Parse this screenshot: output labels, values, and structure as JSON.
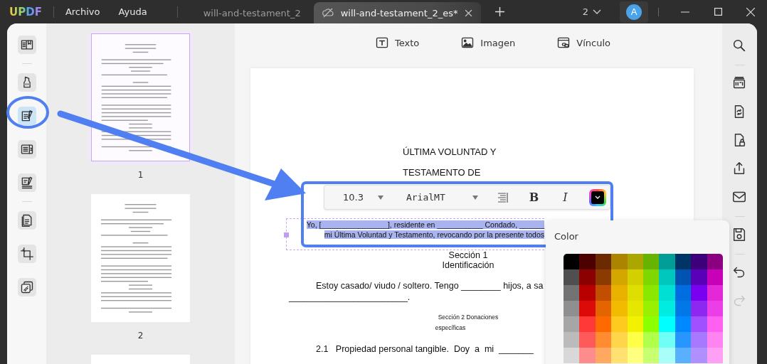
{
  "app": {
    "logo": "UPDF",
    "menu": [
      {
        "label": "Archivo"
      },
      {
        "label": "Ayuda"
      }
    ]
  },
  "tabs": [
    {
      "label": "will-and-testament_2",
      "selected": false
    },
    {
      "label": "will-and-testament_2_es*",
      "selected": true
    }
  ],
  "page_switcher": {
    "label": "2"
  },
  "user": {
    "initial": "A"
  },
  "left_toolbar": {
    "groups": [
      [
        {
          "selected": false
        }
      ],
      [
        {
          "selected": false
        },
        {
          "selected": true
        },
        {
          "selected": false
        },
        {
          "selected": false
        }
      ],
      [
        {
          "selected": false
        },
        {
          "selected": false
        },
        {
          "selected": false
        }
      ]
    ]
  },
  "thumbnails": [
    {
      "label": "1",
      "selected": true
    },
    {
      "label": "2",
      "selected": false
    },
    {
      "selected": false
    }
  ],
  "edit_toolbar": [
    {
      "label": "Texto"
    },
    {
      "label": "Imagen"
    },
    {
      "label": "Vínculo"
    }
  ],
  "document": {
    "blocks": [
      {
        "kind": "title",
        "selected": false,
        "lines": [
          "ÚLTIMA VOLUNTAD Y",
          "TESTAMENTO DE"
        ]
      },
      {
        "kind": "paragraph-right",
        "selected": true,
        "lines": [
          "Yo, [________________], residente en ___________ Condado, ______",
          "mi Última Voluntad y Testamento, revocando por la presente todos"
        ]
      },
      {
        "kind": "heading",
        "selected": false,
        "lines": [
          "Sección 1",
          "Identificación"
        ]
      },
      {
        "kind": "paragraph",
        "selected": false,
        "lines": [
          "Estoy casado/ viudo / soltero. Tengo ________ hijos, a sa",
          "________________________."
        ]
      },
      {
        "kind": "small-heading",
        "selected": false,
        "lines": [
          "Sección 2 Donaciones",
          "específicas"
        ]
      },
      {
        "kind": "paragraph",
        "selected": false,
        "lines": [
          "2.1   Propiedad personal tangible.  Doy  a  mi  _______"
        ]
      }
    ]
  },
  "text_format": {
    "font_size": "10.3",
    "font": "ArialMT",
    "bold_label": "B",
    "italic_label": "I"
  },
  "color_picker": {
    "title": "Color",
    "rows": [
      [
        {
          "color": "#000000"
        },
        {
          "color": "#4d0000"
        },
        {
          "color": "#6b2a00"
        },
        {
          "color": "#ad8400"
        },
        {
          "color": "#aba700"
        },
        {
          "color": "#66b400"
        },
        {
          "color": "#009e96"
        },
        {
          "color": "#003366"
        },
        {
          "color": "#3d007a"
        },
        {
          "color": "#8a0080"
        }
      ],
      [
        {
          "color": "#4f4f4f"
        },
        {
          "color": "#8b0000"
        },
        {
          "color": "#8b3a00"
        },
        {
          "color": "#d4a600"
        },
        {
          "color": "#d4d000"
        },
        {
          "color": "#7fd600"
        },
        {
          "color": "#00c7be"
        },
        {
          "color": "#0053b0"
        },
        {
          "color": "#5a00b8"
        },
        {
          "color": "#c800b8"
        }
      ],
      [
        {
          "color": "#737373"
        },
        {
          "color": "#b80000"
        },
        {
          "color": "#c24e00"
        },
        {
          "color": "#eab200"
        },
        {
          "color": "#dede00"
        },
        {
          "color": "#8ae800"
        },
        {
          "color": "#00dfd4"
        },
        {
          "color": "#006ee0"
        },
        {
          "color": "#7a00f0"
        },
        {
          "color": "#e428d8"
        }
      ],
      [
        {
          "color": "#8f8f8f"
        },
        {
          "color": "#dd0a0a"
        },
        {
          "color": "#e46400"
        },
        {
          "color": "#f2ba00"
        },
        {
          "color": "#e6e600"
        },
        {
          "color": "#99f000"
        },
        {
          "color": "#00ece0"
        },
        {
          "color": "#0078e8"
        },
        {
          "color": "#8c28f0"
        },
        {
          "color": "#ec3ee6"
        }
      ],
      [
        {
          "color": "#a6a6a6"
        },
        {
          "color": "#ff3838"
        },
        {
          "color": "#ff6a00"
        },
        {
          "color": "#ffca20"
        },
        {
          "color": "#f2f200"
        },
        {
          "color": "#8cff00"
        },
        {
          "color": "#00ffff"
        },
        {
          "color": "#0088ff"
        },
        {
          "color": "#a050ff"
        },
        {
          "color": "#ff60f0"
        }
      ],
      [
        {
          "color": "#bbbbbb"
        },
        {
          "color": "#ff5a5a"
        },
        {
          "color": "#ff8c30"
        },
        {
          "color": "#ffd54a"
        },
        {
          "color": "#ffff4a"
        },
        {
          "color": "#b0ff4a"
        },
        {
          "color": "#70fff5"
        },
        {
          "color": "#2896ff"
        },
        {
          "color": "#a878ff"
        },
        {
          "color": "#ff84f2"
        }
      ],
      [
        {
          "color": "#d8d8d8"
        },
        {
          "color": "#ff8c8c"
        },
        {
          "color": "#ffa860"
        },
        {
          "color": "#ffe070"
        },
        {
          "color": "#ffff80"
        },
        {
          "color": "#c8ff70"
        },
        {
          "color": "#a8fffa"
        },
        {
          "color": "#58b0ff"
        },
        {
          "color": "#b090ff"
        },
        {
          "color": "#ffa0f4"
        }
      ]
    ]
  },
  "right_toolbar": {
    "groups": [
      [
        {
          "disabled": false
        }
      ],
      [
        {
          "disabled": false
        },
        {
          "disabled": false
        },
        {
          "disabled": false
        },
        {
          "disabled": false
        },
        {
          "disabled": false
        }
      ],
      [
        {
          "disabled": false
        }
      ],
      [
        {
          "disabled": false
        },
        {
          "disabled": true
        }
      ]
    ]
  }
}
